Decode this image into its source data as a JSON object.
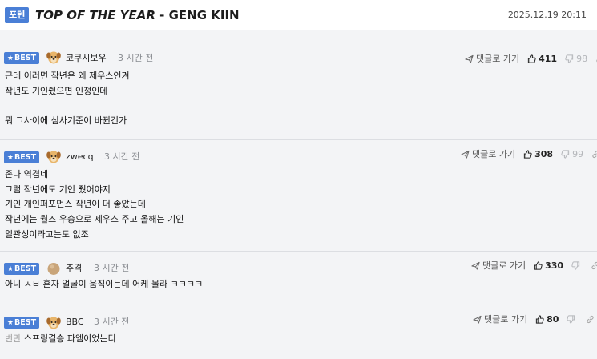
{
  "header": {
    "category": "포텐",
    "title_bold": "TOP OF THE YEAR",
    "title_rest": " - GENG KIIN",
    "datetime": "2025.12.19 20:11"
  },
  "labels": {
    "best": "BEST",
    "reply_link": "댓글로 가기"
  },
  "comments": [
    {
      "nick": "코쿠시보우",
      "time": "3 시간 전",
      "up": "411",
      "down": "98",
      "avatar": "dog-avatar",
      "body": "근데 이러면 작년은 왜 제우스인겨\n작년도 기인줬으면 인정인데\n\n뭐 그사이에 심사기준이 바뀐건가"
    },
    {
      "nick": "zwecq",
      "time": "3 시간 전",
      "up": "308",
      "down": "99",
      "avatar": "dog-avatar",
      "body": "존나 역겹네\n그럼 작년에도 기인 줬어야지\n기인 개인퍼포먼스 작년이 더 좋았는데\n작년에는 월즈 우승으로 제우스 주고 올해는 기인\n일관성이라고는도 없조"
    },
    {
      "nick": "추격",
      "time": "3 시간 전",
      "up": "330",
      "down": "",
      "avatar": "ball-avatar",
      "body": "아니 ㅅㅂ 혼자 얼굴이 움직이는데 어케 몰라 ㅋㅋㅋㅋ"
    },
    {
      "nick": "BBC",
      "time": "3 시간 전",
      "up": "80",
      "down": "",
      "avatar": "dog-avatar",
      "body_prefix": "번만",
      "body": " 스프링결승 파엠이었는디"
    }
  ],
  "colors": {
    "accent": "#4a7fd6",
    "background": "#f3f4f6",
    "muted_text": "#8a8d92"
  }
}
